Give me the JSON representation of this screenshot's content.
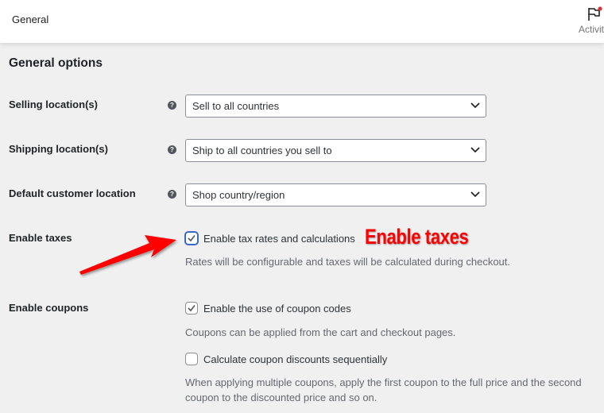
{
  "topbar": {
    "title": "General",
    "activity_label": "Activity",
    "activity_icon": "flag-icon",
    "notification_color": "#d63638"
  },
  "section": {
    "title": "General options"
  },
  "fields": {
    "selling": {
      "label": "Selling location(s)",
      "value": "Sell to all countries"
    },
    "shipping": {
      "label": "Shipping location(s)",
      "value": "Ship to all countries you sell to"
    },
    "customer": {
      "label": "Default customer location",
      "value": "Shop country/region"
    },
    "taxes": {
      "label": "Enable taxes",
      "checkbox_label": "Enable tax rates and calculations",
      "checked": true,
      "description": "Rates will be configurable and taxes will be calculated during checkout."
    },
    "coupons": {
      "label": "Enable coupons",
      "checkbox_label": "Enable the use of coupon codes",
      "checked": true,
      "description": "Coupons can be applied from the cart and checkout pages.",
      "sequential_label": "Calculate coupon discounts sequentially",
      "sequential_checked": false,
      "sequential_description": "When applying multiple coupons, apply the first coupon to the full price and the second coupon to the discounted price and so on."
    }
  },
  "annotation": {
    "text": "Enable taxes",
    "color": "#ff0000"
  },
  "help_glyph": "?"
}
